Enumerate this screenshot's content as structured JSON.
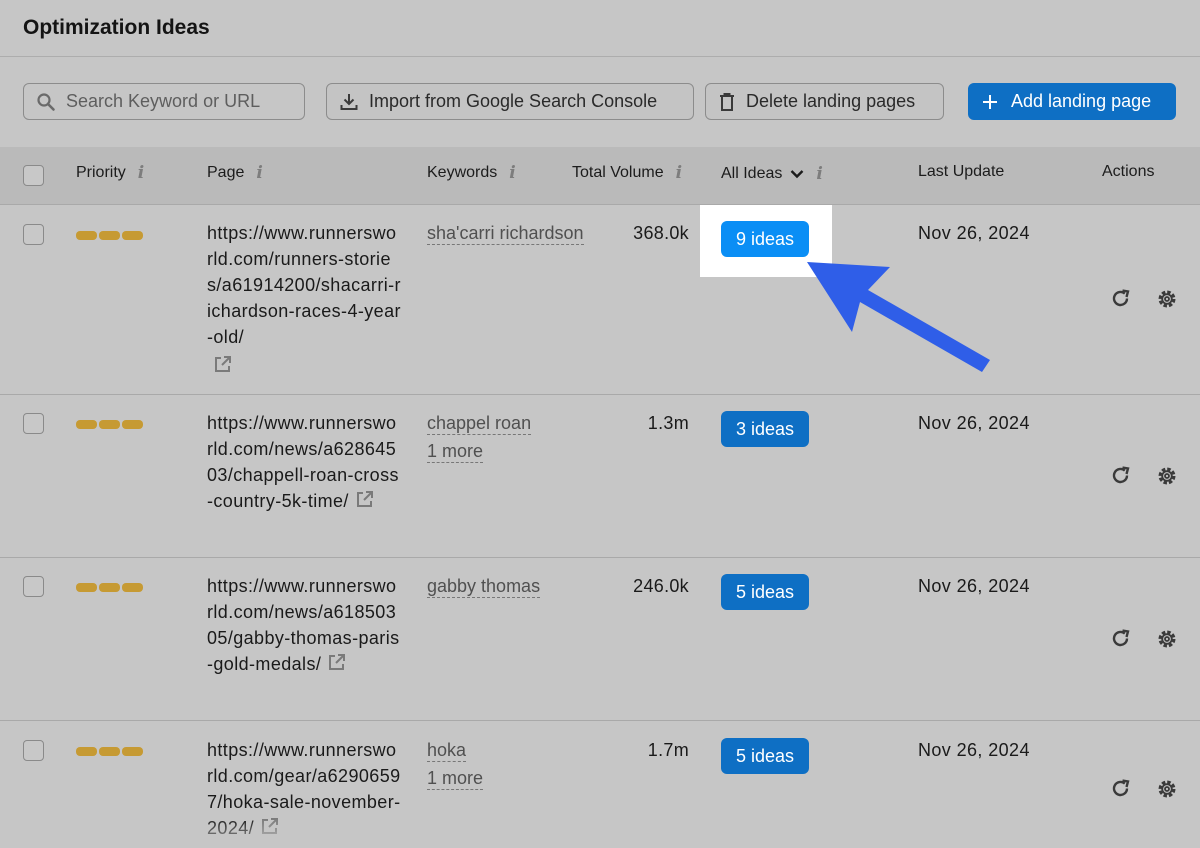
{
  "header": {
    "title": "Optimization Ideas"
  },
  "toolbar": {
    "search_placeholder": "Search Keyword or URL",
    "import_label": "Import from Google Search Console",
    "delete_label": "Delete landing pages",
    "add_label": "Add landing page"
  },
  "table": {
    "columns": {
      "priority": "Priority",
      "page": "Page",
      "keywords": "Keywords",
      "volume": "Total Volume",
      "ideas": "All Ideas",
      "last_update": "Last Update",
      "actions": "Actions"
    },
    "info_glyph": "i",
    "rows": [
      {
        "url": "https://www.runnersworld.com/runners-stories/a61914200/shacarri-richardson-races-4-year-old/",
        "keyword": "sha'carri richardson",
        "more": "",
        "volume": "368.0k",
        "ideas": "9 ideas",
        "date": "Nov 26, 2024"
      },
      {
        "url": "https://www.runnersworld.com/news/a62864503/chappell-roan-cross-country-5k-time/",
        "keyword": "chappel roan",
        "more": "1 more",
        "volume": "1.3m",
        "ideas": "3 ideas",
        "date": "Nov 26, 2024"
      },
      {
        "url": "https://www.runnersworld.com/news/a61850305/gabby-thomas-paris-gold-medals/",
        "keyword": "gabby thomas",
        "more": "",
        "volume": "246.0k",
        "ideas": "5 ideas",
        "date": "Nov 26, 2024"
      },
      {
        "url": "https://www.runnersworld.com/gear/a62906597/hoka-sale-november-2024/",
        "keyword": "hoka",
        "more": "1 more",
        "volume": "1.7m",
        "ideas": "5 ideas",
        "date": "Nov 26, 2024"
      }
    ]
  },
  "icons": {
    "search": "search-icon",
    "import": "download-icon",
    "delete": "trash-icon",
    "add": "plus-icon",
    "external": "external-link-icon",
    "refresh": "refresh-icon",
    "settings": "gear-icon",
    "sort": "chevron-down-icon"
  },
  "colors": {
    "primary_button": "#0e6fc4",
    "highlighted_button": "#0a8ef5",
    "priority_bar": "#c69a33",
    "annotation_arrow": "#2f5ee8"
  }
}
